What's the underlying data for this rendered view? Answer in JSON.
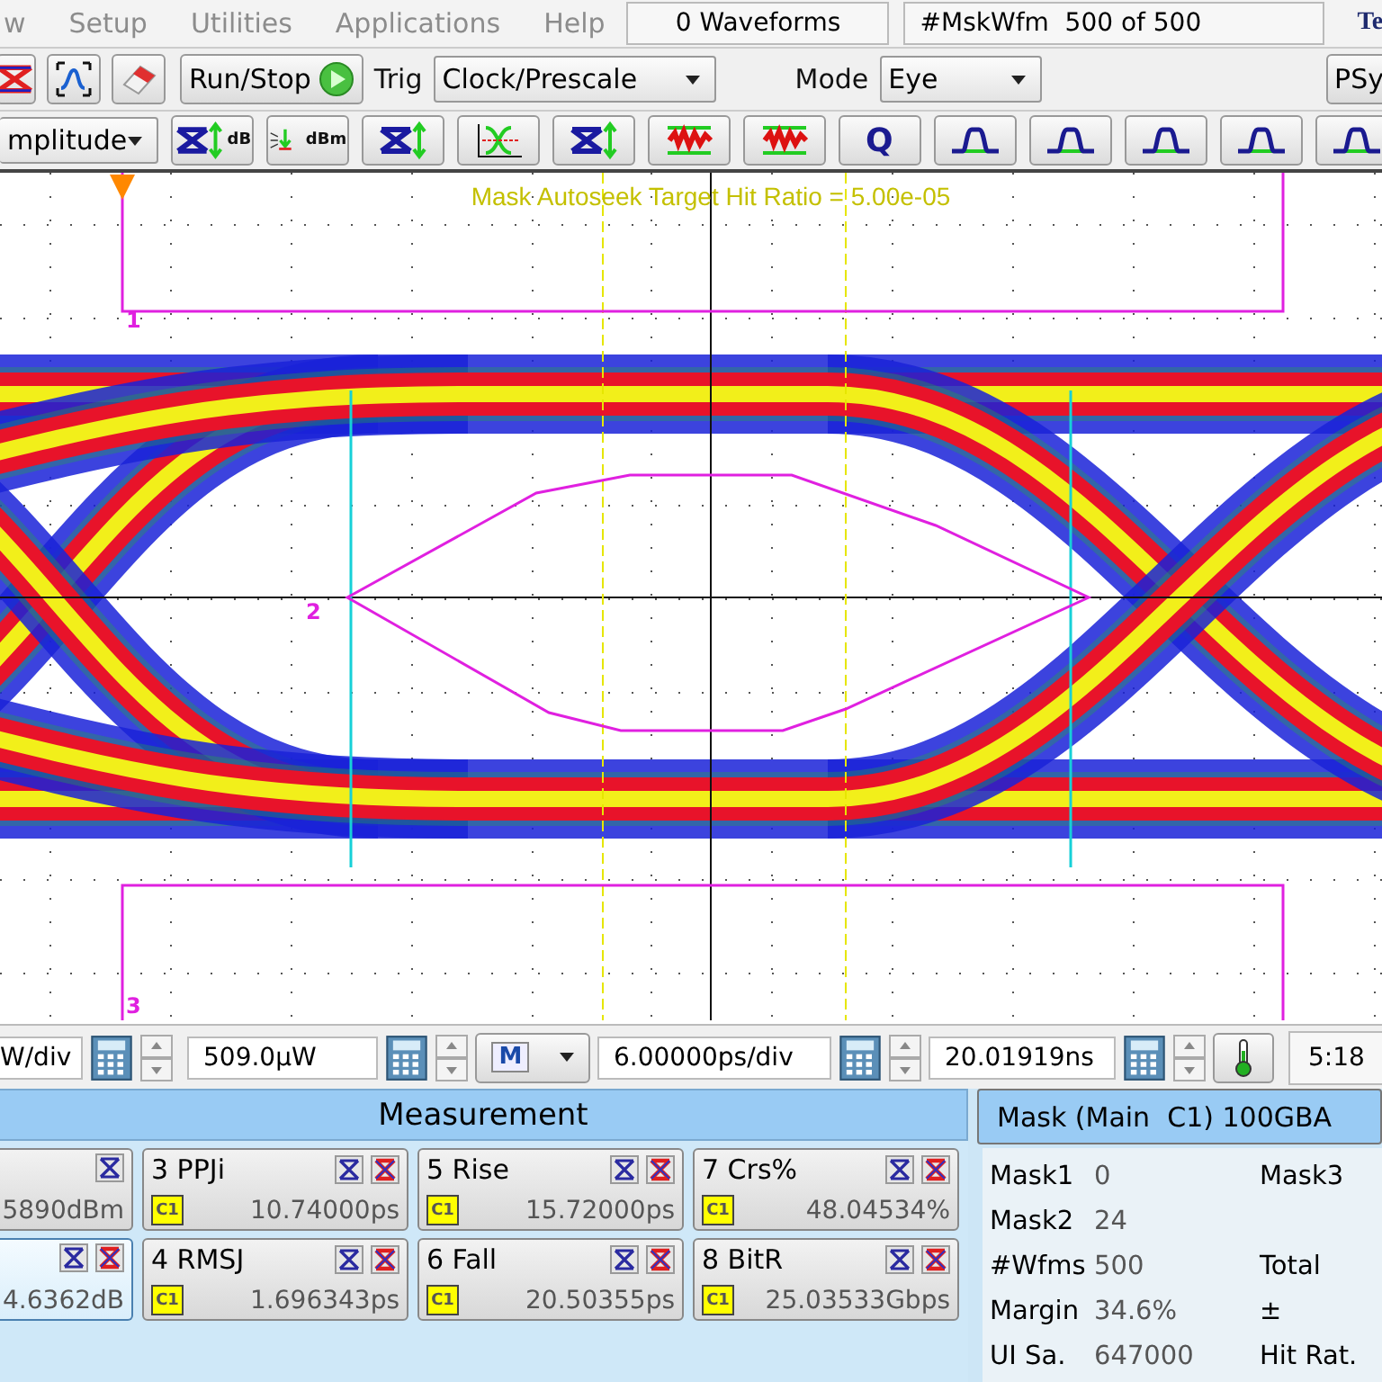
{
  "menu": [
    {
      "label": "w"
    },
    {
      "label": "Setup"
    },
    {
      "label": "Utilities"
    },
    {
      "label": "Applications"
    },
    {
      "label": "Help"
    }
  ],
  "status": {
    "waveforms": "0 Waveforms",
    "mask_count": "#MskWfm  500 of 500",
    "logo": "Te"
  },
  "toolbar": {
    "run_stop": "Run/Stop",
    "trig_label": "Trig",
    "trig_value": "Clock/Prescale",
    "mode_label": "Mode",
    "mode_value": "Eye",
    "psy": "PSy"
  },
  "meas_select": "mplitude",
  "tools": [
    {
      "kind": "eye",
      "label": "dB"
    },
    {
      "kind": "arrows",
      "label": "dBm"
    },
    {
      "kind": "eye"
    },
    {
      "kind": "crossing"
    },
    {
      "kind": "eye"
    },
    {
      "kind": "noise"
    },
    {
      "kind": "noise"
    },
    {
      "kind": "letter",
      "label": "Q"
    },
    {
      "kind": "pulse"
    },
    {
      "kind": "pulse"
    },
    {
      "kind": "pulse"
    },
    {
      "kind": "pulse"
    },
    {
      "kind": "pulse"
    }
  ],
  "display": {
    "overlay": "Mask Autoseek Target Hit Ratio = 5.00e-05",
    "mask_labels": [
      "1",
      "2",
      "3"
    ]
  },
  "controls": {
    "vertical_scale": "W/div",
    "vertical_offset": "509.0µW",
    "horizontal_scale": "6.00000ps/div",
    "position": "20.01919ns",
    "time": "5:18",
    "math_key": "M"
  },
  "measurement": {
    "title": "Measurement",
    "cells": [
      {
        "value": "5890dBm",
        "hit_icon": false,
        "selected": false
      },
      {
        "name": "3 PPJi",
        "source": "C1",
        "value": "10.74000ps",
        "hit_icon": true,
        "selected": false
      },
      {
        "name": "5 Rise",
        "source": "C1",
        "value": "15.72000ps",
        "hit_icon": true,
        "selected": false
      },
      {
        "name": "7 Crs%",
        "source": "C1",
        "value": "48.04534%",
        "hit_icon": true,
        "selected": false
      },
      {
        "value": "4.6362dB",
        "hit_icon": true,
        "selected": true
      },
      {
        "name": "4 RMSJ",
        "source": "C1",
        "value": "1.696343ps",
        "hit_icon": true,
        "selected": false
      },
      {
        "name": "6 Fall",
        "source": "C1",
        "value": "20.50355ps",
        "hit_icon": true,
        "selected": false
      },
      {
        "name": "8 BitR",
        "source": "C1",
        "value": "25.03533Gbps",
        "hit_icon": true,
        "selected": false
      }
    ]
  },
  "mask": {
    "title": "Mask (Main  C1) 100GBA",
    "rows": [
      {
        "label": "Mask1",
        "value": "0",
        "label_2": "Mask3"
      },
      {
        "label": "Mask2",
        "value": "24"
      },
      {
        "label": "#Wfms",
        "value": "500",
        "label_2": "Total"
      },
      {
        "label": "Margin",
        "value": "34.6%",
        "label_2": "±"
      },
      {
        "label": "UI Sa.",
        "value": "647000",
        "label_2": "Hit Rat."
      }
    ]
  }
}
